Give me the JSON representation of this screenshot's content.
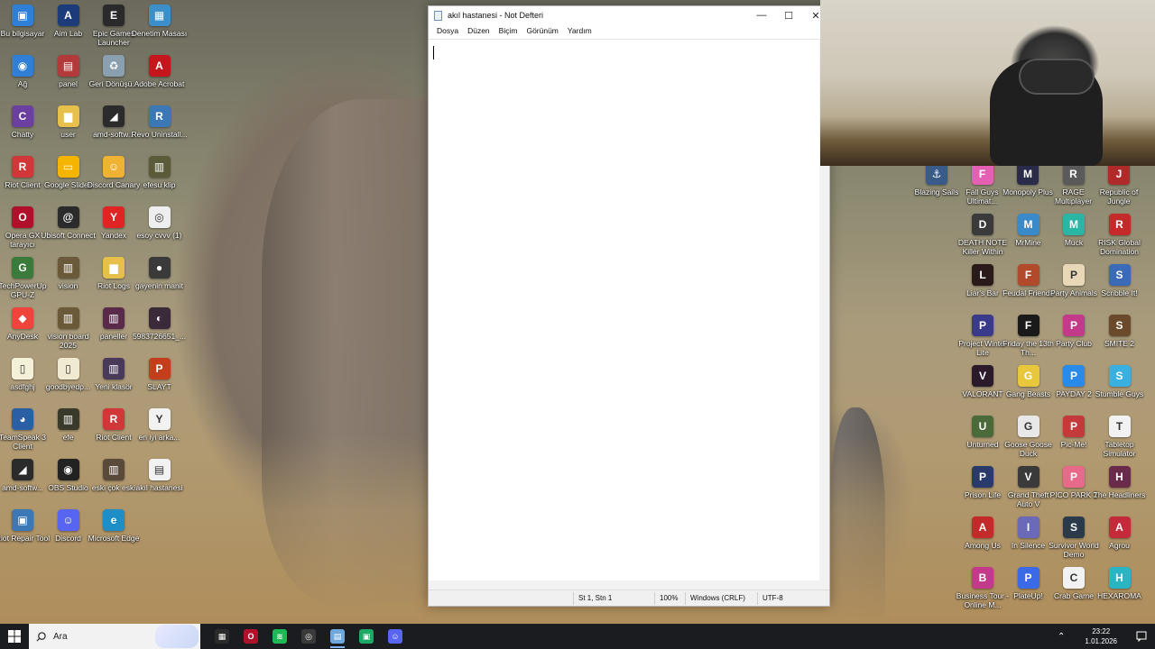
{
  "desktop": {
    "left_icons": [
      {
        "label": "Bu bilgisayar",
        "icon": "computer-icon",
        "color": "#2f7fd6",
        "glyph": "▣"
      },
      {
        "label": "Aim Lab",
        "icon": "aimlab-icon",
        "color": "#1c3b7a",
        "glyph": "A"
      },
      {
        "label": "Epic Games Launcher",
        "icon": "epic-games-icon",
        "color": "#2a2a2a",
        "glyph": "E"
      },
      {
        "label": "Denetim Masası",
        "icon": "control-panel-icon",
        "color": "#3d8fc9",
        "glyph": "▦"
      },
      {
        "label": "Ağ",
        "icon": "network-icon",
        "color": "#2f7fd6",
        "glyph": "◉"
      },
      {
        "label": "panel",
        "icon": "folder-panel-icon",
        "color": "#b23a3a",
        "glyph": "▤"
      },
      {
        "label": "Geri Dönüşü...",
        "icon": "recycle-bin-icon",
        "color": "#8aa0b0",
        "glyph": "♻"
      },
      {
        "label": "Adobe Acrobat",
        "icon": "adobe-acrobat-icon",
        "color": "#c4161c",
        "glyph": "A"
      },
      {
        "label": "Chatty",
        "icon": "chatty-icon",
        "color": "#6b3fa0",
        "glyph": "C"
      },
      {
        "label": "user",
        "icon": "folder-user-icon",
        "color": "#e6c04a",
        "glyph": "▆"
      },
      {
        "label": "amd-softw...",
        "icon": "amd-software-icon",
        "color": "#2b2b2b",
        "glyph": "◢"
      },
      {
        "label": "Revo Uninstall...",
        "icon": "revo-uninstaller-icon",
        "color": "#3c78b5",
        "glyph": "R"
      },
      {
        "label": "Riot Client",
        "icon": "riot-client-icon",
        "color": "#d13639",
        "glyph": "R"
      },
      {
        "label": "Google Slides",
        "icon": "google-slides-icon",
        "color": "#f4b400",
        "glyph": "▭"
      },
      {
        "label": "Discord Canary",
        "icon": "discord-canary-icon",
        "color": "#f0b232",
        "glyph": "☺"
      },
      {
        "label": "efesu klip",
        "icon": "folder-efesu-icon",
        "color": "#5b5b3a",
        "glyph": "▥"
      },
      {
        "label": "Opera GX tarayıcı",
        "icon": "opera-gx-icon",
        "color": "#b0102a",
        "glyph": "O"
      },
      {
        "label": "Ubisoft Connect",
        "icon": "ubisoft-connect-icon",
        "color": "#2b2b2b",
        "glyph": "@"
      },
      {
        "label": "Yandex",
        "icon": "yandex-icon",
        "color": "#e02424",
        "glyph": "Y"
      },
      {
        "label": "esoy cvvv (1)",
        "icon": "chrome-shortcut-icon",
        "color": "#eeeeee",
        "glyph": "◎"
      },
      {
        "label": "TechPowerUp GPU-Z",
        "icon": "gpu-z-icon",
        "color": "#3a7a3a",
        "glyph": "G"
      },
      {
        "label": "vision",
        "icon": "folder-vision-icon",
        "color": "#6a5a3a",
        "glyph": "▥"
      },
      {
        "label": "Riot Logs",
        "icon": "folder-riot-logs-icon",
        "color": "#e6c04a",
        "glyph": "▆"
      },
      {
        "label": "gayenin manit",
        "icon": "image-file-icon",
        "color": "#3a3a3a",
        "glyph": "●"
      },
      {
        "label": "AnyDesk",
        "icon": "anydesk-icon",
        "color": "#ef443b",
        "glyph": "◆"
      },
      {
        "label": "vision board 2025",
        "icon": "folder-vision-board-icon",
        "color": "#6a5a3a",
        "glyph": "▥"
      },
      {
        "label": "paneller",
        "icon": "folder-paneller-icon",
        "color": "#5a2a4a",
        "glyph": "▥"
      },
      {
        "label": "5983726651_...",
        "icon": "photo-file-icon",
        "color": "#3a2a3a",
        "glyph": "◐"
      },
      {
        "label": "asdfghj",
        "icon": "text-file-icon",
        "color": "#f5f0d8",
        "glyph": "▯"
      },
      {
        "label": "goodbyedp...",
        "icon": "file-goodbye-icon",
        "color": "#f0ead0",
        "glyph": "▯"
      },
      {
        "label": "Yeni klasör",
        "icon": "folder-new-icon",
        "color": "#4a3a5a",
        "glyph": "▥"
      },
      {
        "label": "SLAYT",
        "icon": "powerpoint-icon",
        "color": "#c43e1c",
        "glyph": "P"
      },
      {
        "label": "TeamSpeak 3 Client",
        "icon": "teamspeak-icon",
        "color": "#2a5fa5",
        "glyph": "◕"
      },
      {
        "label": "efe",
        "icon": "folder-efe-icon",
        "color": "#3a3a2a",
        "glyph": "▥"
      },
      {
        "label": "Riot Client",
        "icon": "riot-client-2-icon",
        "color": "#d13639",
        "glyph": "R"
      },
      {
        "label": "en iyi arka...",
        "icon": "yandex-file-icon",
        "color": "#f2f2f2",
        "glyph": "Y"
      },
      {
        "label": "amd-softw...",
        "icon": "amd-software-2-icon",
        "color": "#2b2b2b",
        "glyph": "◢"
      },
      {
        "label": "OBS Studio",
        "icon": "obs-studio-icon",
        "color": "#222222",
        "glyph": "◉"
      },
      {
        "label": "eski çok eski",
        "icon": "folder-eski-icon",
        "color": "#5a4a3a",
        "glyph": "▥"
      },
      {
        "label": "akıl hastanesi",
        "icon": "text-file-akil-icon",
        "color": "#f2f2f2",
        "glyph": "▤"
      },
      {
        "label": "Riot Repair Tool",
        "icon": "riot-repair-icon",
        "color": "#3c78b5",
        "glyph": "▣"
      },
      {
        "label": "Discord",
        "icon": "discord-icon",
        "color": "#5865f2",
        "glyph": "☺"
      },
      {
        "label": "Microsoft Edge",
        "icon": "edge-icon",
        "color": "#1f8ec6",
        "glyph": "e"
      }
    ],
    "right_icons": [
      {
        "label": "Blazing Sails",
        "icon": "blazing-sails-icon",
        "color": "#3a5a8a",
        "glyph": "⚓"
      },
      {
        "label": "Fall Guys Ultimat...",
        "icon": "fall-guys-icon",
        "color": "#e55fb3",
        "glyph": "F"
      },
      {
        "label": "Monopoly Plus",
        "icon": "monopoly-icon",
        "color": "#2a2a4a",
        "glyph": "M"
      },
      {
        "label": "RAGE Multiplayer",
        "icon": "rage-mp-icon",
        "color": "#5a5a5a",
        "glyph": "R"
      },
      {
        "label": "Republic of Jungle",
        "icon": "republic-jungle-icon",
        "color": "#b02a2a",
        "glyph": "J"
      },
      {
        "label": "DEATH NOTE Killer Within",
        "icon": "death-note-icon",
        "color": "#3a3a3a",
        "glyph": "D"
      },
      {
        "label": "MrMine",
        "icon": "mrmine-icon",
        "color": "#3a8ac9",
        "glyph": "M"
      },
      {
        "label": "Muck",
        "icon": "muck-icon",
        "color": "#2ab5a5",
        "glyph": "M"
      },
      {
        "label": "RISK Global Domination",
        "icon": "risk-icon",
        "color": "#c42a2a",
        "glyph": "R"
      },
      {
        "label": "Liar's Bar",
        "icon": "liars-bar-icon",
        "color": "#2a1a1a",
        "glyph": "L"
      },
      {
        "label": "Feudal Friends",
        "icon": "feudal-friends-icon",
        "color": "#b04a2a",
        "glyph": "F"
      },
      {
        "label": "Party Animals",
        "icon": "party-animals-icon",
        "color": "#e8d8b8",
        "glyph": "P"
      },
      {
        "label": "Scribble It!",
        "icon": "scribble-it-icon",
        "color": "#3a6ab8",
        "glyph": "S"
      },
      {
        "label": "Project Winter Lite",
        "icon": "project-winter-icon",
        "color": "#3a3a8a",
        "glyph": "P"
      },
      {
        "label": "Friday the 13th Th...",
        "icon": "friday-13th-icon",
        "color": "#1a1a1a",
        "glyph": "F"
      },
      {
        "label": "Party Club",
        "icon": "party-club-icon",
        "color": "#c43a8a",
        "glyph": "P"
      },
      {
        "label": "SMITE 2",
        "icon": "smite2-icon",
        "color": "#6a4a2a",
        "glyph": "S"
      },
      {
        "label": "VALORANT",
        "icon": "valorant-icon",
        "color": "#2a1a2a",
        "glyph": "V"
      },
      {
        "label": "Gang Beasts",
        "icon": "gang-beasts-icon",
        "color": "#e8c83a",
        "glyph": "G"
      },
      {
        "label": "PAYDAY 2",
        "icon": "payday2-icon",
        "color": "#2a8ae8",
        "glyph": "P"
      },
      {
        "label": "Stumble Guys",
        "icon": "stumble-guys-icon",
        "color": "#3ab0e0",
        "glyph": "S"
      },
      {
        "label": "Unturned",
        "icon": "unturned-icon",
        "color": "#4a6a3a",
        "glyph": "U"
      },
      {
        "label": "Goose Goose Duck",
        "icon": "goose-goose-duck-icon",
        "color": "#e8e8e8",
        "glyph": "G"
      },
      {
        "label": "Pic-Me!",
        "icon": "pic-me-icon",
        "color": "#c43a3a",
        "glyph": "P"
      },
      {
        "label": "Tabletop Simulator",
        "icon": "tabletop-simulator-icon",
        "color": "#f2f2f2",
        "glyph": "T"
      },
      {
        "label": "Prison Life",
        "icon": "prison-life-icon",
        "color": "#2a3a6a",
        "glyph": "P"
      },
      {
        "label": "Grand Theft Auto V",
        "icon": "gta5-icon",
        "color": "#3a3a3a",
        "glyph": "V"
      },
      {
        "label": "PICO PARK 2",
        "icon": "pico-park-icon",
        "color": "#e86a8a",
        "glyph": "P"
      },
      {
        "label": "The Headliners",
        "icon": "headliners-icon",
        "color": "#6a2a4a",
        "glyph": "H"
      },
      {
        "label": "Among Us",
        "icon": "among-us-icon",
        "color": "#c42a2a",
        "glyph": "A"
      },
      {
        "label": "In Silence",
        "icon": "in-silence-icon",
        "color": "#6a6ab8",
        "glyph": "I"
      },
      {
        "label": "Survivor World Demo",
        "icon": "survivor-world-icon",
        "color": "#2a3a4a",
        "glyph": "S"
      },
      {
        "label": "Agrou",
        "icon": "agrou-icon",
        "color": "#c42a3a",
        "glyph": "A"
      },
      {
        "label": "Business Tour - Online M...",
        "icon": "business-tour-icon",
        "color": "#c43a8a",
        "glyph": "B"
      },
      {
        "label": "PlateUp!",
        "icon": "plateup-icon",
        "color": "#3a6ae8",
        "glyph": "P"
      },
      {
        "label": "Crab Game",
        "icon": "crab-game-icon",
        "color": "#f2f2f2",
        "glyph": "C"
      },
      {
        "label": "HEXAROMA",
        "icon": "hexaroma-icon",
        "color": "#2ab5c4",
        "glyph": "H"
      }
    ]
  },
  "notepad": {
    "title": "akıl hastanesi - Not Defteri",
    "menu": [
      "Dosya",
      "Düzen",
      "Biçim",
      "Görünüm",
      "Yardım"
    ],
    "content": "",
    "status": {
      "position": "St 1, Stn 1",
      "zoom": "100%",
      "line_ending": "Windows (CRLF)",
      "encoding": "UTF-8"
    }
  },
  "taskbar": {
    "search_placeholder": "Ara",
    "apps": [
      {
        "name": "taskbar-microsoft-store",
        "icon": "store-icon",
        "color": "#2b2b2b",
        "glyph": "▦"
      },
      {
        "name": "taskbar-opera-gx",
        "icon": "opera-gx-icon",
        "color": "#b0102a",
        "glyph": "O"
      },
      {
        "name": "taskbar-spotify",
        "icon": "spotify-icon",
        "color": "#1db954",
        "glyph": "≋"
      },
      {
        "name": "taskbar-chrome",
        "icon": "chrome-icon",
        "color": "#3a3a3a",
        "glyph": "◎"
      },
      {
        "name": "taskbar-notepad",
        "icon": "notepad-icon",
        "color": "#6fa8dc",
        "glyph": "▤"
      },
      {
        "name": "taskbar-app-green",
        "icon": "green-app-icon",
        "color": "#1ea866",
        "glyph": "▣"
      },
      {
        "name": "taskbar-discord",
        "icon": "discord-icon",
        "color": "#5865f2",
        "glyph": "☺"
      }
    ],
    "clock_time": "23:22",
    "clock_date": "1.01.2026"
  }
}
